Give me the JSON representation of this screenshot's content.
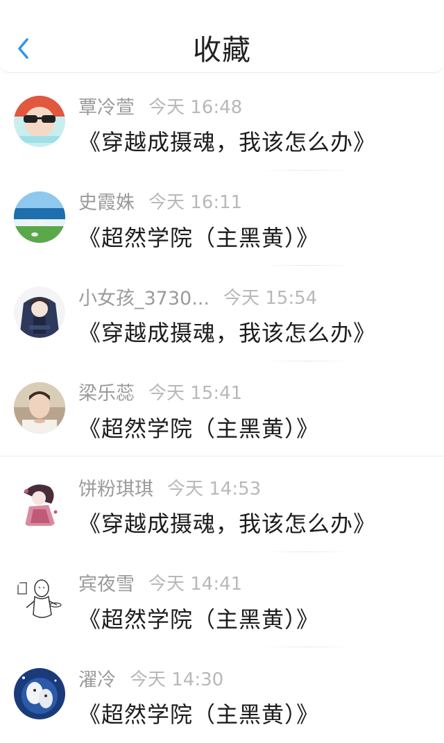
{
  "header": {
    "title": "收藏"
  },
  "favorites": [
    {
      "name": "覃冷萱",
      "time": "今天 16:48",
      "work": "《穿越成摄魂，我该怎么办》",
      "avatar": "avatar-user-sunglasses"
    },
    {
      "name": "史霞姝",
      "time": "今天 16:11",
      "work": "《超然学院（主黑黄）》",
      "avatar": "avatar-seagulls-beach"
    },
    {
      "name": "小女孩_3730...",
      "time": "今天 15:54",
      "work": "《穿越成摄魂，我该怎么办》",
      "avatar": "avatar-anime-throne"
    },
    {
      "name": "梁乐蕊",
      "time": "今天 15:41",
      "work": "《超然学院（主黑黄）》",
      "avatar": "avatar-portrait-man"
    },
    {
      "name": "饼粉琪琪",
      "time": "今天 14:53",
      "work": "《穿越成摄魂，我该怎么办》",
      "avatar": "avatar-anime-girl-pink"
    },
    {
      "name": "宾夜雪",
      "time": "今天 14:41",
      "work": "《超然学院（主黑黄）》",
      "avatar": "avatar-sketch-figure"
    },
    {
      "name": "濯冷",
      "time": "今天 14:30",
      "work": "《超然学院（主黑黄）》",
      "avatar": "avatar-dark-blue"
    }
  ],
  "colors": {
    "accent": "#2f95e6",
    "name_text": "#9a9a9a",
    "time_text": "#b8b8b8",
    "work_text": "#1c1c1c"
  },
  "icons": {
    "back": "chevron-left-icon"
  }
}
